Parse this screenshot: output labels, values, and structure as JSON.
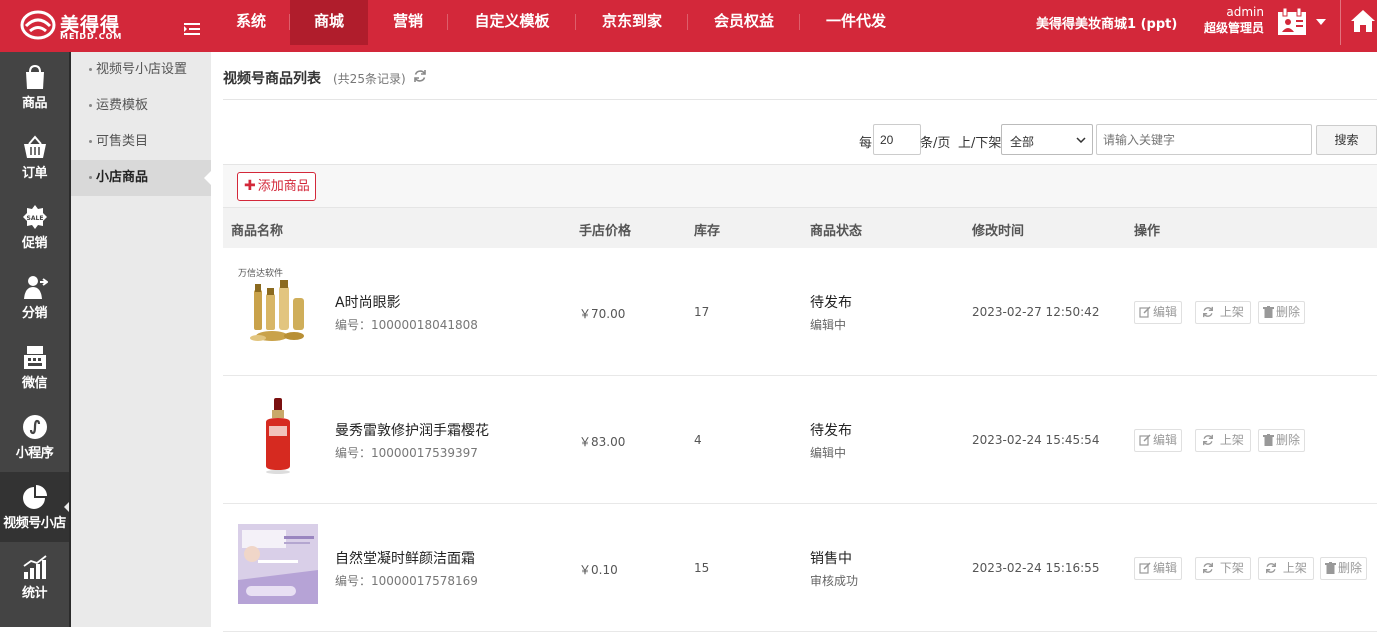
{
  "brand": {
    "name": "美得得",
    "sub": "MEIDD.COM",
    "color": "#d3283a"
  },
  "top_nav": [
    {
      "label": "系统",
      "active": false
    },
    {
      "label": "商城",
      "active": true
    },
    {
      "label": "营销",
      "active": false
    },
    {
      "label": "自定义模板",
      "active": false
    },
    {
      "label": "京东到家",
      "active": false
    },
    {
      "label": "会员权益",
      "active": false
    },
    {
      "label": "一件代发",
      "active": false
    }
  ],
  "header": {
    "shop_name": "美得得美妆商城1 (ppt)",
    "user": "admin",
    "role": "超级管理员"
  },
  "icon_sidebar": [
    {
      "label": "商品",
      "icon": "bag-icon"
    },
    {
      "label": "订单",
      "icon": "basket-icon"
    },
    {
      "label": "促销",
      "icon": "sale-icon"
    },
    {
      "label": "分销",
      "icon": "distribution-icon"
    },
    {
      "label": "微信",
      "icon": "cash-register-icon"
    },
    {
      "label": "小程序",
      "icon": "miniprogram-icon"
    },
    {
      "label": "视频号小店",
      "icon": "pie-chart-icon",
      "active": true
    },
    {
      "label": "统计",
      "icon": "stats-icon"
    }
  ],
  "sub_nav": [
    {
      "label": "视频号小店设置",
      "active": false
    },
    {
      "label": "运费模板",
      "active": false
    },
    {
      "label": "可售类目",
      "active": false
    },
    {
      "label": "小店商品",
      "active": true
    }
  ],
  "page": {
    "title": "视频号商品列表",
    "count_text": "(共25条记录)"
  },
  "filter": {
    "per_prefix": "每",
    "per_value": "20",
    "per_suffix": "条/页",
    "shelf_label": "上/下架",
    "shelf_value": "全部",
    "keyword_placeholder": "请输入关键字",
    "search_label": "搜索"
  },
  "toolbar": {
    "add_label": "添加商品"
  },
  "table": {
    "headers": [
      "商品名称",
      "手店价格",
      "库存",
      "商品状态",
      "修改时间",
      "操作"
    ],
    "rows": [
      {
        "name": "A时尚眼影",
        "code": "编号：10000018041808",
        "watermark": "万信达软件",
        "price": "￥70.00",
        "stock": "17",
        "status": "待发布",
        "sub_status": "编辑中",
        "time": "2023-02-27 12:50:42",
        "ops": [
          "编辑",
          "上架",
          "删除"
        ]
      },
      {
        "name": "曼秀雷敦修护润手霜樱花",
        "code": "编号：10000017539397",
        "price": "￥83.00",
        "stock": "4",
        "status": "待发布",
        "sub_status": "编辑中",
        "time": "2023-02-24 15:45:54",
        "ops": [
          "编辑",
          "上架",
          "删除"
        ]
      },
      {
        "name": "自然堂凝时鲜颜洁面霜",
        "code": "编号：10000017578169",
        "price": "￥0.10",
        "stock": "15",
        "status": "销售中",
        "sub_status": "审核成功",
        "time": "2023-02-24 15:16:55",
        "ops": [
          "编辑",
          "下架",
          "上架",
          "删除"
        ]
      }
    ]
  }
}
